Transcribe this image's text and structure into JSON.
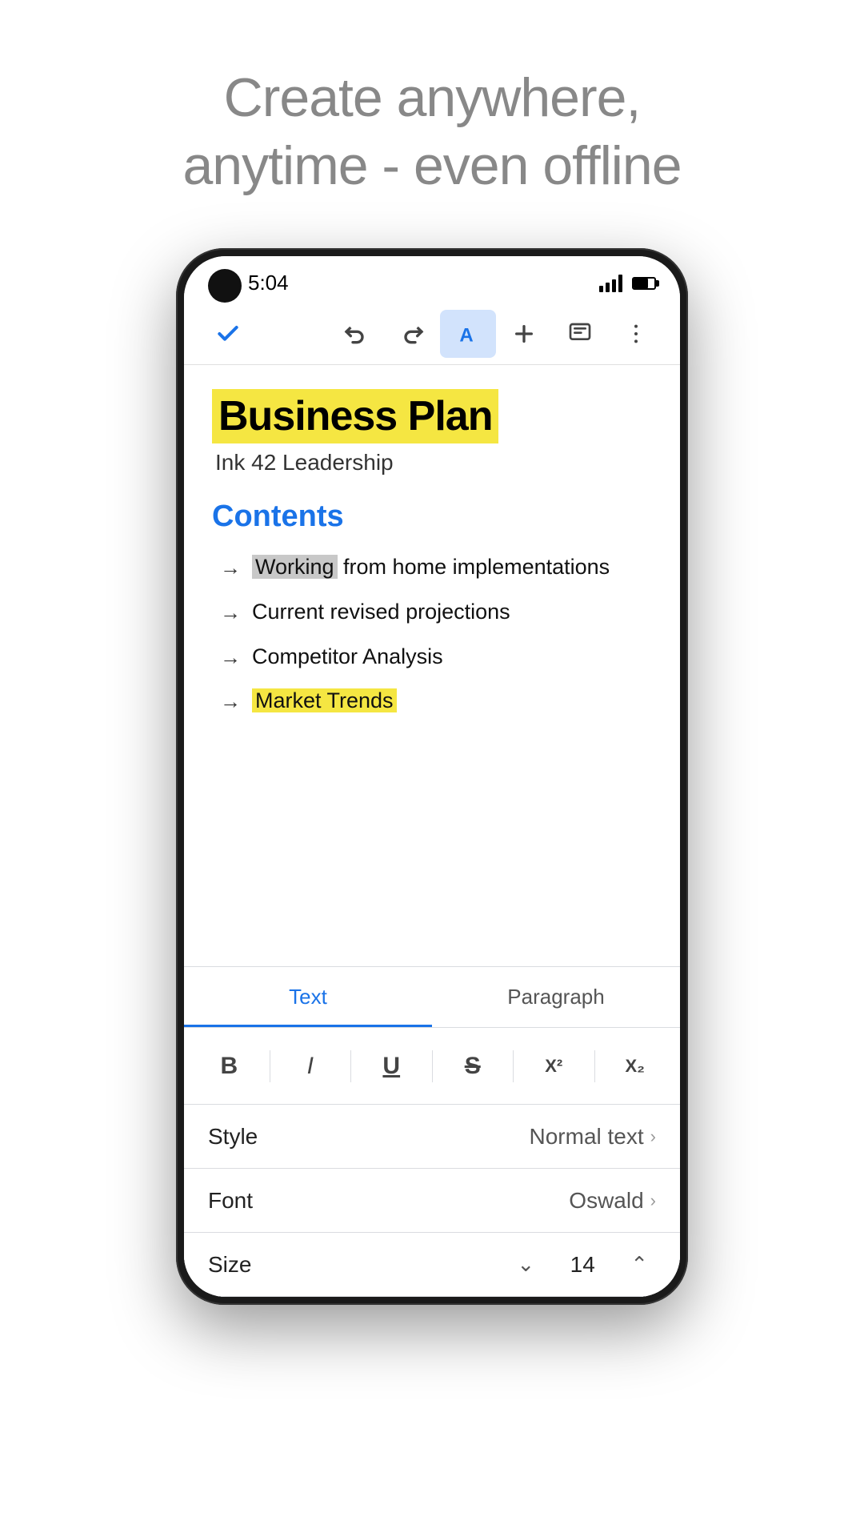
{
  "hero": {
    "line1": "Create anywhere,",
    "line2": "anytime - even offline"
  },
  "phone": {
    "status": {
      "time": "5:04"
    },
    "toolbar": {
      "check_label": "✓",
      "undo_label": "↺",
      "redo_label": "↻",
      "text_format_label": "A",
      "add_label": "+",
      "comment_label": "☰",
      "more_label": "⋮"
    },
    "document": {
      "title": "Business Plan",
      "subtitle": "Ink 42 Leadership",
      "section": "Contents",
      "items": [
        {
          "text_before": "",
          "highlight": "Working",
          "text_after": " from home implementations"
        },
        {
          "text_before": "Current revised projections",
          "highlight": "",
          "text_after": ""
        },
        {
          "text_before": "Competitor Analysis",
          "highlight": "",
          "text_after": ""
        },
        {
          "text_before": "",
          "highlight": "Market Trends",
          "text_after": ""
        }
      ]
    },
    "format_panel": {
      "tab_text": "Text",
      "tab_paragraph": "Paragraph",
      "bold": "B",
      "italic": "I",
      "underline": "U",
      "strikethrough": "S",
      "superscript": "X²",
      "subscript": "X₂",
      "style_label": "Style",
      "style_value": "Normal text",
      "font_label": "Font",
      "font_value": "Oswald",
      "size_label": "Size",
      "size_value": "14"
    }
  }
}
